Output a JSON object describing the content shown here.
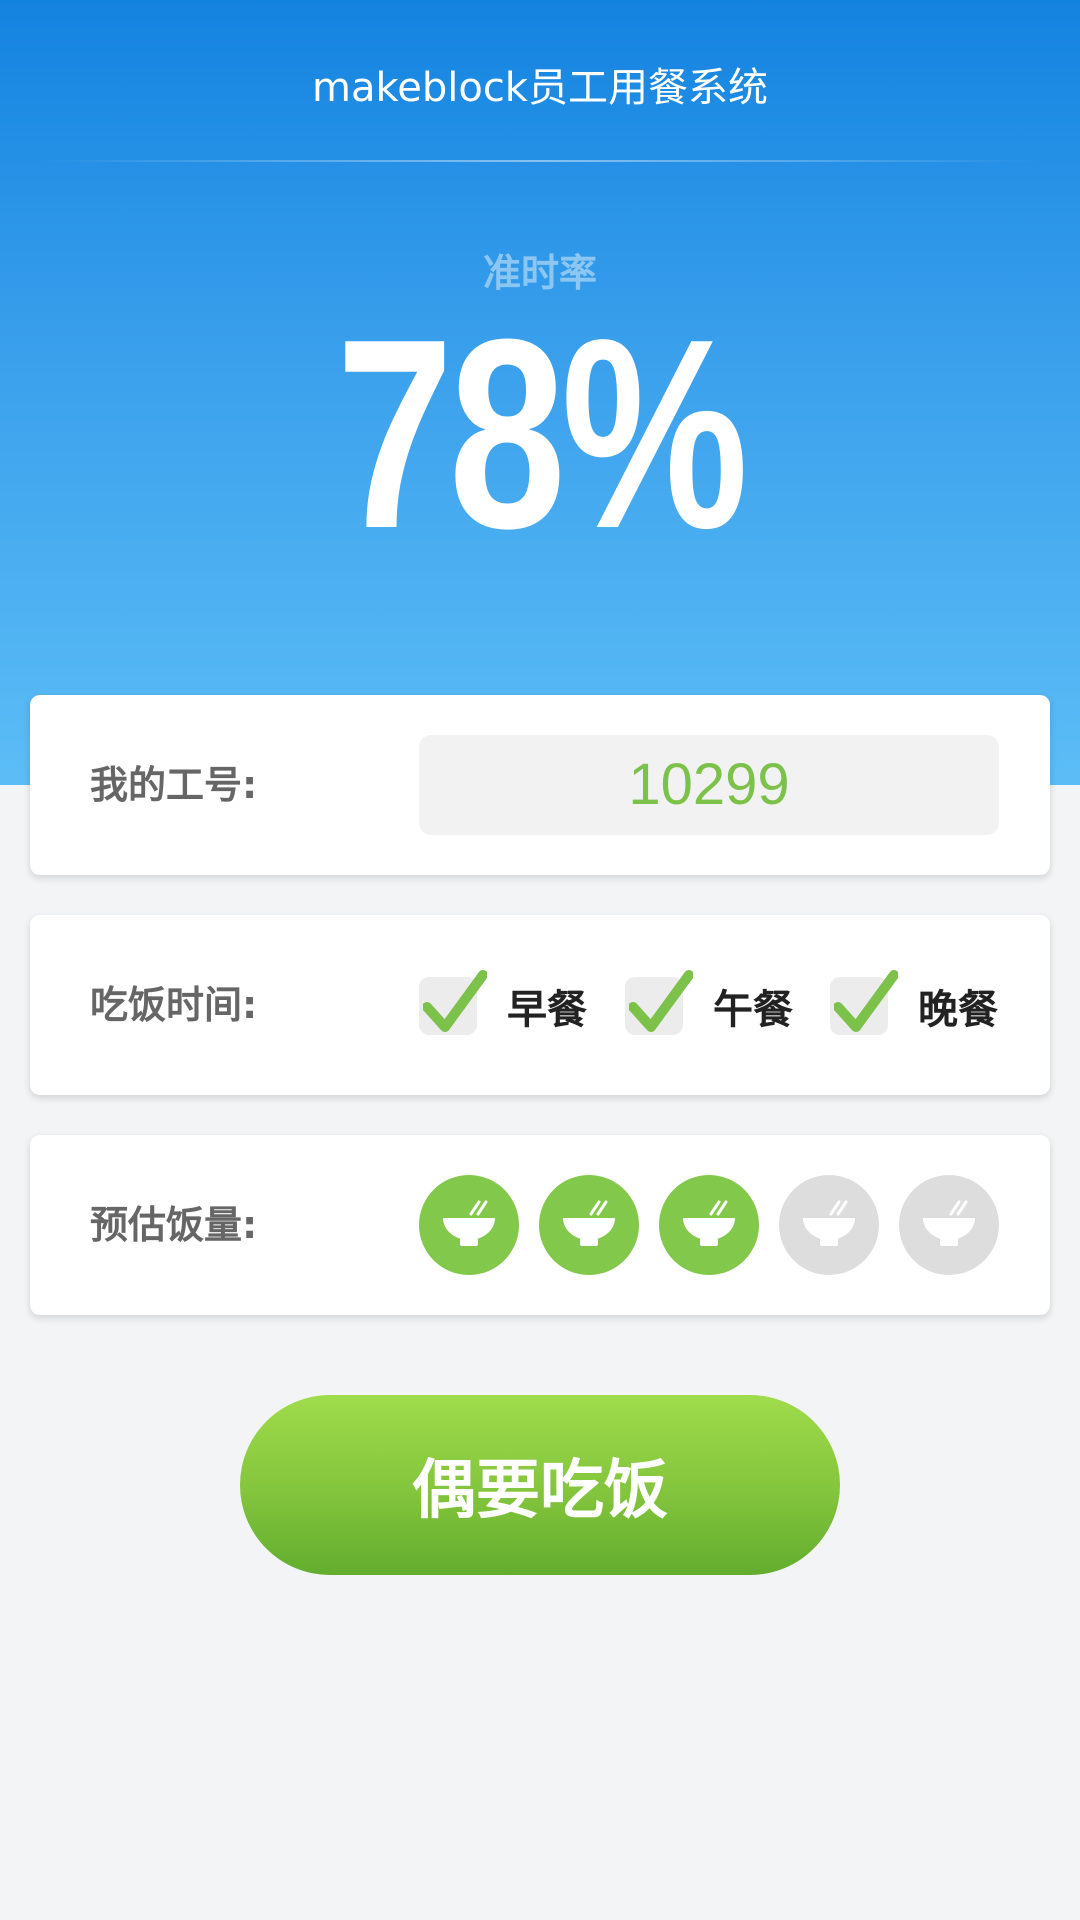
{
  "header": {
    "title": "makeblock员工用餐系统"
  },
  "stats": {
    "rate_label": "准时率",
    "rate_value": "78%"
  },
  "employee": {
    "label": "我的工号:",
    "id": "10299"
  },
  "meals": {
    "label": "吃饭时间:",
    "options": [
      {
        "label": "早餐",
        "checked": true
      },
      {
        "label": "午餐",
        "checked": true
      },
      {
        "label": "晚餐",
        "checked": true
      }
    ]
  },
  "portion": {
    "label": "预估饭量:",
    "selected": 3,
    "max": 5,
    "icon": "rice-bowl-icon"
  },
  "action": {
    "label": "偶要吃饭"
  },
  "colors": {
    "primary_blue": "#1383e0",
    "accent_green": "#82c84a",
    "inactive_gray": "#dddddd"
  }
}
